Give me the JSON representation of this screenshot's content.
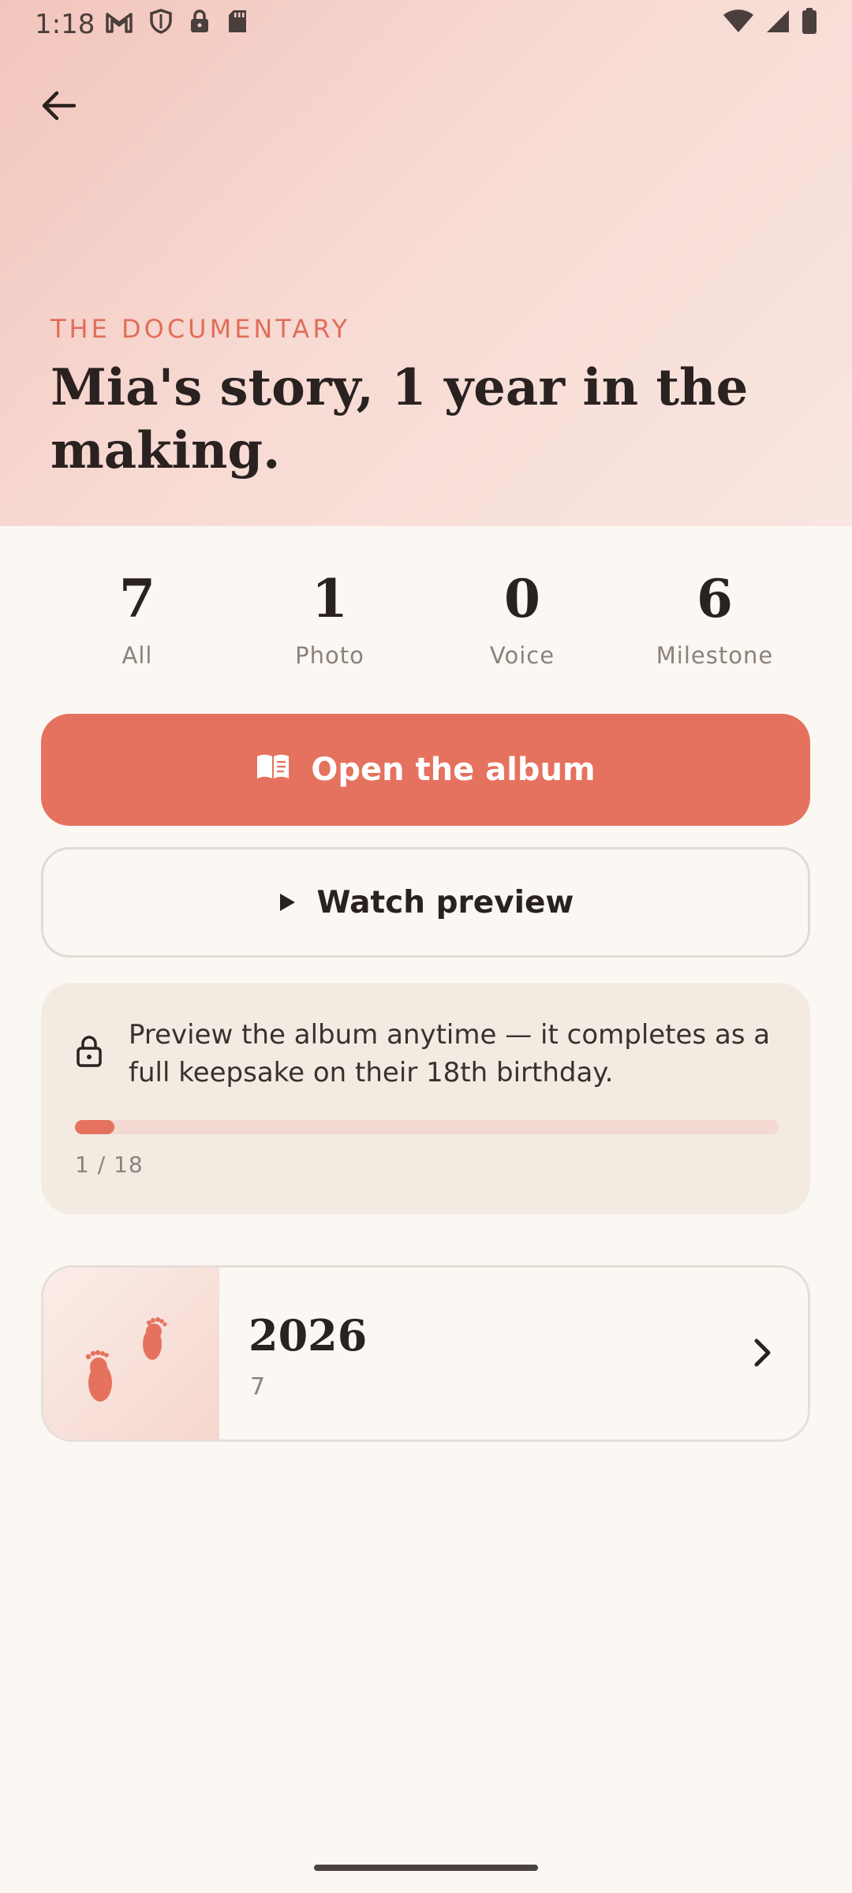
{
  "status_bar": {
    "time": "1:18",
    "left_icons": [
      "gmail-icon",
      "shield-icon",
      "lock-icon",
      "sd-card-icon"
    ],
    "right_icons": [
      "wifi-icon",
      "signal-icon",
      "battery-icon"
    ]
  },
  "header": {
    "back_icon": "arrow-left-icon",
    "kicker": "THE DOCUMENTARY",
    "title": "Mia's story, 1 year in the making."
  },
  "stats": [
    {
      "value": "7",
      "label": "All"
    },
    {
      "value": "1",
      "label": "Photo"
    },
    {
      "value": "0",
      "label": "Voice"
    },
    {
      "value": "6",
      "label": "Milestone"
    }
  ],
  "actions": {
    "open_album": {
      "label": "Open the album",
      "icon": "book-open-icon"
    },
    "watch_preview": {
      "label": "Watch preview",
      "icon": "play-icon"
    }
  },
  "info": {
    "icon": "lock-icon",
    "text": "Preview the album anytime — it completes as a full keepsake on their 18th birthday.",
    "progress_current": 1,
    "progress_total": 18,
    "progress_label": "1 / 18"
  },
  "years": [
    {
      "year": "2026",
      "count": "7",
      "thumb_icon": "baby-feet-icon",
      "chevron": "chevron-right-icon"
    }
  ],
  "colors": {
    "accent": "#E5725E",
    "hero_gradient_start": "#F2C5BC",
    "hero_gradient_end": "#F9E6E0",
    "background": "#FBF7F2",
    "info_card": "#F3EBE2",
    "text_primary": "#2A2220",
    "text_muted": "#8C817D"
  }
}
